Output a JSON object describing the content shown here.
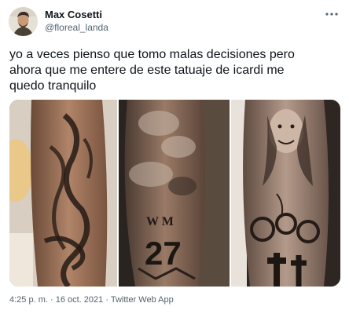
{
  "author": {
    "name": "Max Cosetti",
    "handle": "@floreal_landa"
  },
  "tweet": {
    "text": "yo a veces pienso que tomo malas decisiones pero\nahora que me entere de este tatuaje de icardi me\nquedo tranquilo"
  },
  "media": {
    "tattoo_number": "27",
    "tattoo_initials": "W M"
  },
  "meta": {
    "time": "4:25 p. m.",
    "separator": " · ",
    "date": "16 oct. 2021",
    "source": "Twitter Web App"
  },
  "icons": {
    "more": "more-horizontal-icon",
    "avatar": "avatar"
  }
}
